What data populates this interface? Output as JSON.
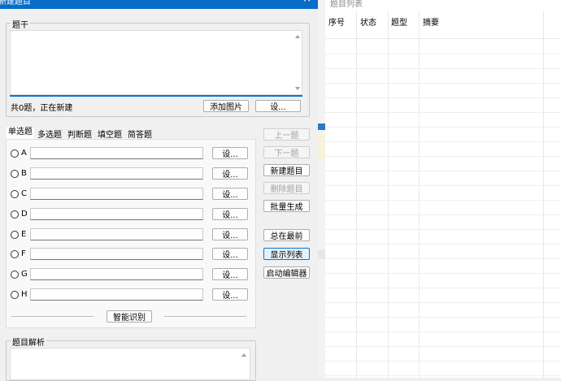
{
  "window": {
    "title": "新建题目",
    "close_glyph": "×"
  },
  "stem": {
    "legend": "题干",
    "value": "",
    "status": "共0题，正在新建",
    "add_image_label": "添加图片",
    "settings_label": "设..."
  },
  "tabs": [
    {
      "label": "单选题",
      "selected": true
    },
    {
      "label": "多选题",
      "selected": false
    },
    {
      "label": "判断题",
      "selected": false
    },
    {
      "label": "填空题",
      "selected": false
    },
    {
      "label": "简答题",
      "selected": false
    }
  ],
  "options": [
    {
      "label": "A",
      "value": "",
      "settings_label": "设..."
    },
    {
      "label": "B",
      "value": "",
      "settings_label": "设..."
    },
    {
      "label": "C",
      "value": "",
      "settings_label": "设..."
    },
    {
      "label": "D",
      "value": "",
      "settings_label": "设..."
    },
    {
      "label": "E",
      "value": "",
      "settings_label": "设..."
    },
    {
      "label": "F",
      "value": "",
      "settings_label": "设..."
    },
    {
      "label": "G",
      "value": "",
      "settings_label": "设..."
    },
    {
      "label": "H",
      "value": "",
      "settings_label": "设..."
    }
  ],
  "smart_recognize_label": "智能识别",
  "side_buttons": {
    "prev": "上一题",
    "next": "下一题",
    "new": "新建题目",
    "delete": "删除题目",
    "batch": "批量生成",
    "always_top": "总在最前",
    "show_list": "显示列表",
    "editor": "启动编辑器"
  },
  "analysis": {
    "legend": "题目解析",
    "value": ""
  },
  "list_panel": {
    "title": "题目列表",
    "columns": [
      "序号",
      "状态",
      "题型",
      "摘要"
    ]
  },
  "colors": {
    "titlebar": "#0a6cc9",
    "accent": "#0078d7"
  }
}
